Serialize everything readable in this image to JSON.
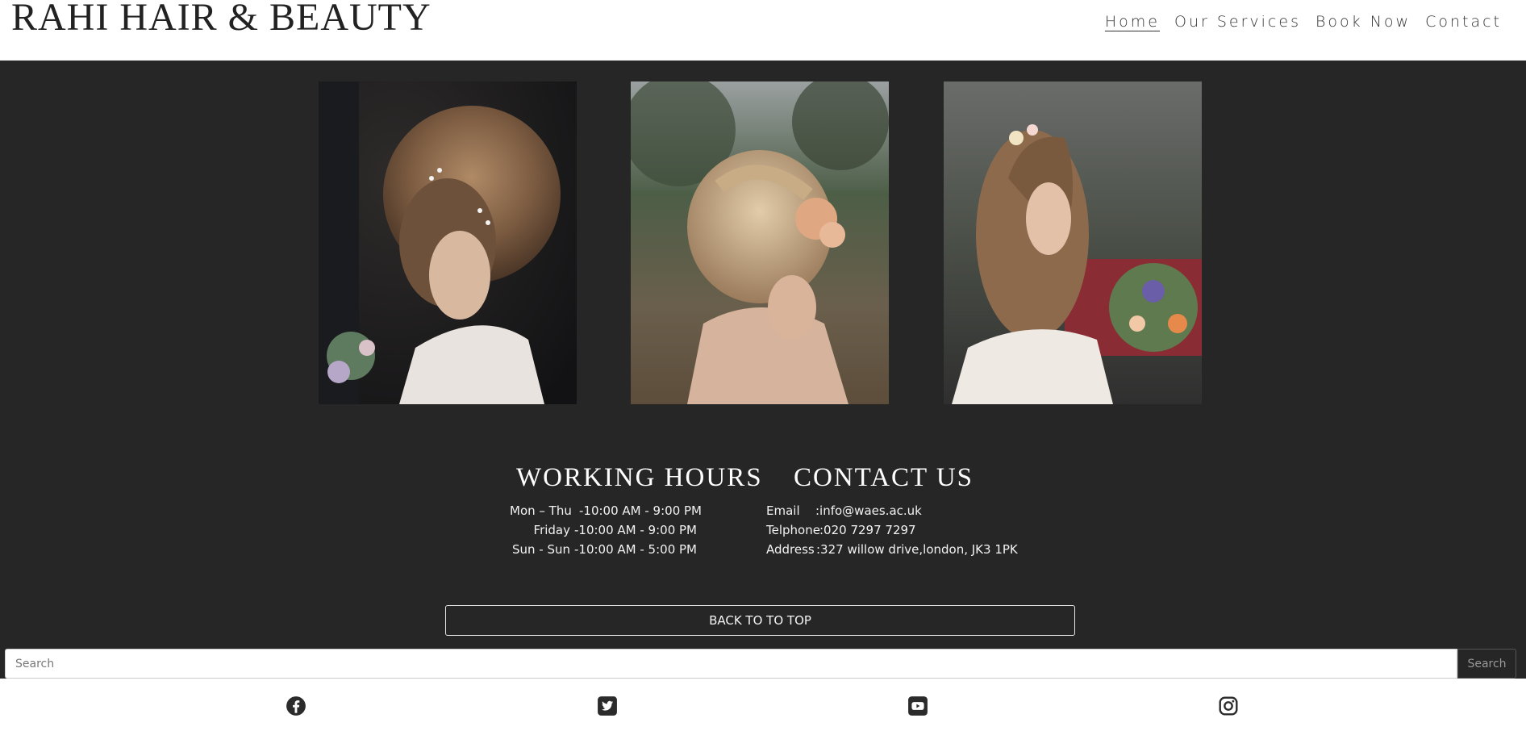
{
  "header": {
    "brand": "RAHI HAIR & BEAUTY",
    "nav": [
      "Home",
      "Our Services",
      "Book Now",
      "Contact"
    ],
    "active_nav": "Home"
  },
  "gallery": {
    "images": [
      "bridal-updo-photo",
      "braided-updo-with-flowers-photo",
      "flower-braid-bride-photo"
    ]
  },
  "working_hours": {
    "title": "WORKING HOURS",
    "rows": [
      {
        "day": "Mon – Thu",
        "time": "-10:00 AM - 9:00 PM"
      },
      {
        "day": "Friday",
        "time": "-10:00 AM - 9:00 PM"
      },
      {
        "day": "Sun - Sun",
        "time": "-10:00 AM - 5:00 PM"
      }
    ]
  },
  "contact": {
    "title": "CONTACT US",
    "rows": [
      {
        "label": "Email",
        "value": ":info@waes.ac.uk"
      },
      {
        "label": "Telphone",
        "value": ":020 7297 7297"
      },
      {
        "label": "Address",
        "value": ":327 willow drive,london, JK3 1PK"
      }
    ]
  },
  "back_to_top": "BACK TO TO TOP",
  "search": {
    "placeholder": "Search",
    "button_label": "Search"
  },
  "social": [
    "facebook-icon",
    "twitter-icon",
    "youtube-icon",
    "instagram-icon"
  ],
  "colors": {
    "dark_background": "#262626",
    "header_background": "#ffffff",
    "text_light": "#ffffff"
  }
}
